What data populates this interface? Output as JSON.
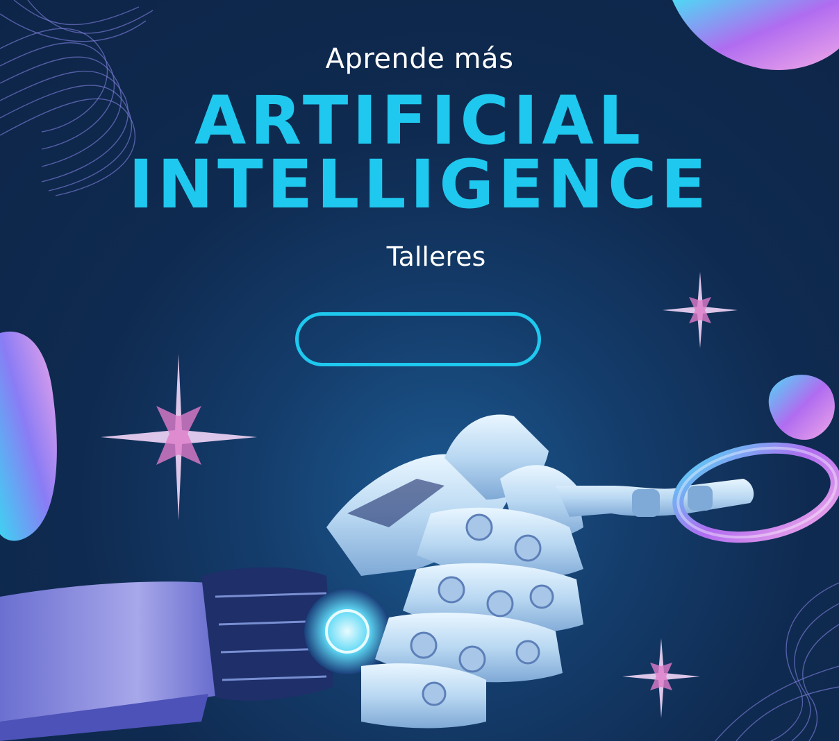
{
  "poster": {
    "kicker": "Aprende más",
    "headline_line1": "ARTIFICIAL",
    "headline_line2": "INTELLIGENCE",
    "label": "Talleres",
    "button_label": ""
  },
  "colors": {
    "background": "#0f2a50",
    "accent": "#1fc8ee",
    "text": "#ffffff",
    "sparkle": "#e8b6f2",
    "blob_cyan": "#4fd8f5",
    "blob_violet": "#b06cf0"
  },
  "decorations": [
    "wire-mesh-waves",
    "iridescent-blob",
    "sparkle-star",
    "robot-hand",
    "holographic-ring"
  ]
}
